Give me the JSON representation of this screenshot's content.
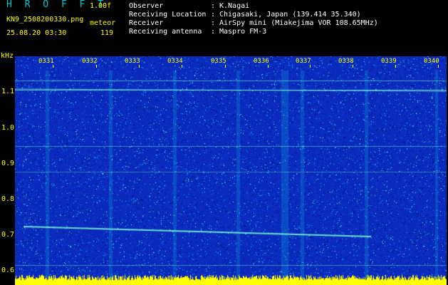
{
  "header": {
    "title": "H R O F F T",
    "version": "1.00f",
    "file_name": "KN9_2508200330.png",
    "station": "meteor",
    "datetime": "25.08.20 03:30",
    "count": "119"
  },
  "info": [
    {
      "key": "Observer",
      "value": "K.Nagai"
    },
    {
      "key": "Receiving Location",
      "value": "Chigasaki, Japan (139.414 35.340)"
    },
    {
      "key": "Receiver",
      "value": "AirSpy mini (Miakejima VOR 108.65MHz)"
    },
    {
      "key": "Receiving antenna",
      "value": "Maspro FM-3"
    }
  ],
  "info_separator": ":",
  "spectrogram": {
    "unit_label": "kHz",
    "y_ticks": [
      {
        "label": "1.1",
        "value": 1.1
      },
      {
        "label": "1.0",
        "value": 1.0
      },
      {
        "label": "0.9",
        "value": 0.9
      },
      {
        "label": "0.8",
        "value": 0.8
      },
      {
        "label": "0.7",
        "value": 0.7
      },
      {
        "label": "0.6",
        "value": 0.6
      }
    ],
    "x_ticks": [
      "0331",
      "0332",
      "0333",
      "0334",
      "0335",
      "0336",
      "0337",
      "0338",
      "0339",
      "0340"
    ],
    "colors": {
      "background": "#0a2bbd",
      "noise_dark": "#000a6a",
      "noise_mid": "#1a5ae8",
      "noise_cyan": "#10c8e8",
      "noise_light": "#80ffd8",
      "signal": "#7cffd0",
      "baseline_yellow": "#ffff00"
    }
  }
}
